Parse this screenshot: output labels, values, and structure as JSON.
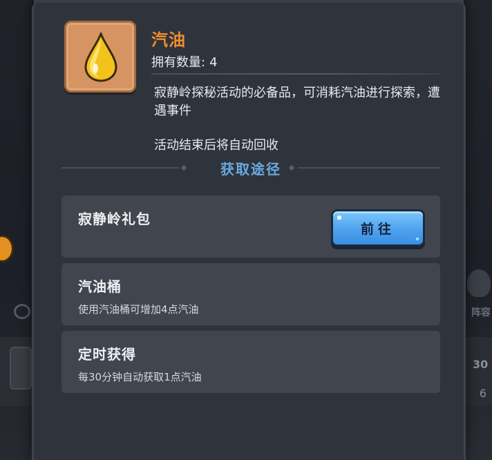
{
  "item": {
    "name": "汽油",
    "owned_label": "拥有数量:",
    "owned_value": "4",
    "description": "寂静岭探秘活动的必备品，可消耗汽油进行探索，遭遇事件",
    "note": "活动结束后将自动回收",
    "icon": "oil-drop-icon"
  },
  "acquire": {
    "title": "获取途径",
    "sources": [
      {
        "title": "寂静岭礼包",
        "subtitle": "",
        "button_label": "前往"
      },
      {
        "title": "汽油桶",
        "subtitle": "使用汽油桶可增加4点汽油"
      },
      {
        "title": "定时获得",
        "subtitle": "每30分钟自动获取1点汽油"
      }
    ]
  },
  "background": {
    "right_label": "阵容",
    "right_num1": "30",
    "right_num2": "6"
  },
  "colors": {
    "panel": "#2f343c",
    "card": "#41464e",
    "item_name": "#f08e2e",
    "section_title": "#6aa9e0",
    "button": "#4fa2ee",
    "icon_bg": "#d59461"
  }
}
